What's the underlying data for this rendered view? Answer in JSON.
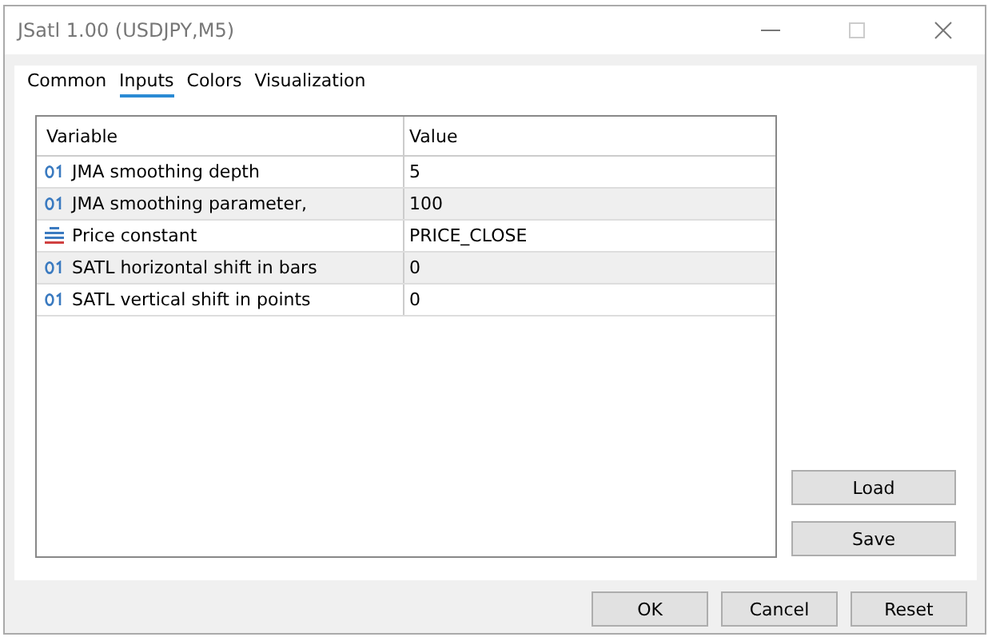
{
  "window": {
    "title": "JSatl 1.00 (USDJPY,M5)"
  },
  "tabs": [
    {
      "label": "Common",
      "selected": false
    },
    {
      "label": "Inputs",
      "selected": true
    },
    {
      "label": "Colors",
      "selected": false
    },
    {
      "label": "Visualization",
      "selected": false
    }
  ],
  "table": {
    "columns": [
      "Variable",
      "Value"
    ],
    "rows": [
      {
        "kind": "number",
        "variable": "JMA smoothing depth",
        "value": "5"
      },
      {
        "kind": "number",
        "variable": "JMA smoothing parameter,",
        "value": "100"
      },
      {
        "kind": "enum",
        "variable": "Price constant",
        "value": "PRICE_CLOSE"
      },
      {
        "kind": "number",
        "variable": "SATL horizontal shift in bars",
        "value": "0"
      },
      {
        "kind": "number",
        "variable": "SATL vertical shift in points",
        "value": "0"
      }
    ]
  },
  "side_buttons": [
    "Load",
    "Save"
  ],
  "buttons": [
    "OK",
    "Cancel",
    "Reset"
  ]
}
